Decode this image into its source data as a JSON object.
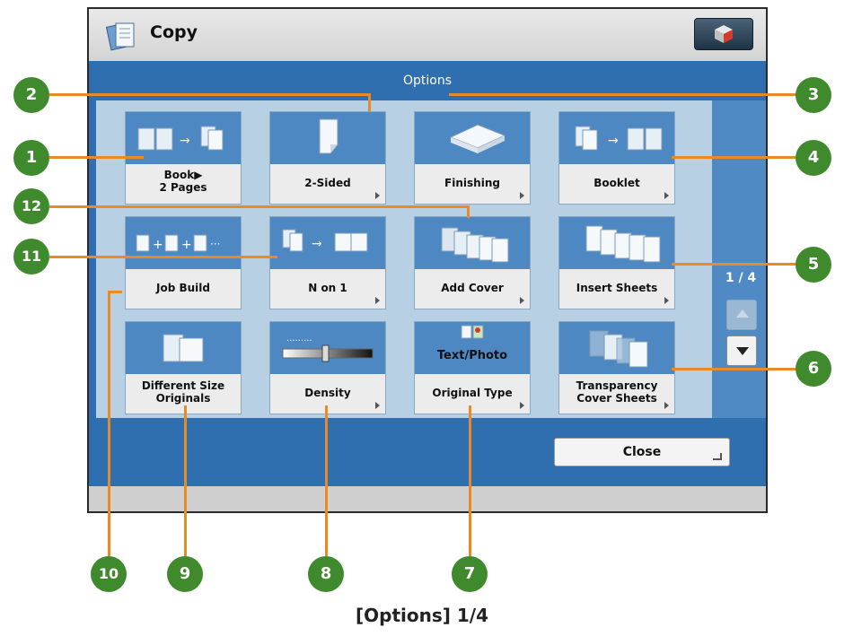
{
  "app": {
    "title": "Copy",
    "icon": "copy-icon"
  },
  "panel": {
    "header": "Options"
  },
  "tiles": [
    {
      "id": "book-2-pages",
      "label": "Book▶\n2 Pages",
      "icon": "book-to-pages-icon"
    },
    {
      "id": "2-sided",
      "label": "2-Sided",
      "icon": "two-sided-icon"
    },
    {
      "id": "finishing",
      "label": "Finishing",
      "icon": "finishing-icon"
    },
    {
      "id": "booklet",
      "label": "Booklet",
      "icon": "booklet-icon"
    },
    {
      "id": "job-build",
      "label": "Job Build",
      "icon": "job-build-icon"
    },
    {
      "id": "n-on-1",
      "label": "N on 1",
      "icon": "n-on-1-icon"
    },
    {
      "id": "add-cover",
      "label": "Add Cover",
      "icon": "add-cover-icon"
    },
    {
      "id": "insert-sheets",
      "label": "Insert Sheets",
      "icon": "insert-sheets-icon"
    },
    {
      "id": "different-size-originals",
      "label": "Different Size\nOriginals",
      "icon": "different-size-icon"
    },
    {
      "id": "density",
      "label": "Density",
      "icon": "density-slider-icon"
    },
    {
      "id": "original-type",
      "label": "Original Type",
      "icon": "text-photo-icon",
      "art_text": "Text/Photo"
    },
    {
      "id": "transparency-cover-sheets",
      "label": "Transparency\nCover Sheets",
      "icon": "transparency-icon"
    }
  ],
  "pagination": {
    "indicator": "1 / 4"
  },
  "close_label": "Close",
  "callouts": [
    "1",
    "2",
    "3",
    "4",
    "5",
    "6",
    "7",
    "8",
    "9",
    "10",
    "11",
    "12"
  ],
  "caption": "[Options] 1/4",
  "colors": {
    "panel_blue": "#2f6fb0",
    "tile_art_blue": "#4e88c2",
    "callout_orange": "#e88a26",
    "badge_green": "#3e8a2c"
  }
}
